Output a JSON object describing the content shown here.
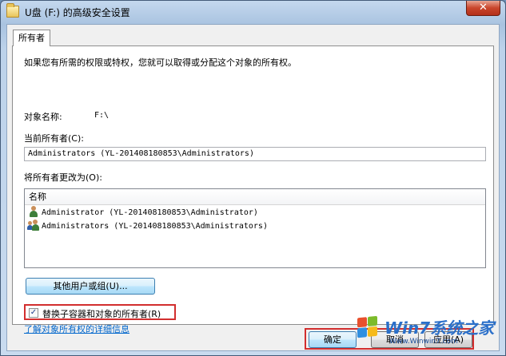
{
  "window": {
    "title": "U盘 (F:) 的高级安全设置",
    "close_glyph": "✕"
  },
  "tabs": [
    {
      "label": "所有者"
    }
  ],
  "panel": {
    "intro": "如果您有所需的权限或特权，您就可以取得或分配这个对象的所有权。",
    "object_name_label": "对象名称:",
    "object_name_value": "F:\\",
    "current_owner_label": "当前所有者(C):",
    "current_owner_value": "Administrators (YL-201408180853\\Administrators)",
    "change_owner_label": "将所有者更改为(O):",
    "list": {
      "header": "名称",
      "items": [
        {
          "icon": "user-icon",
          "text": "Administrator (YL-201408180853\\Administrator)"
        },
        {
          "icon": "group-icon",
          "text": "Administrators (YL-201408180853\\Administrators)"
        }
      ]
    },
    "other_users_button": "其他用户或组(U)...",
    "replace_checkbox": {
      "label": "替换子容器和对象的所有者(R)",
      "checked": true,
      "check_glyph": "✓"
    },
    "learn_more_link": "了解对象所有权的详细信息"
  },
  "buttons": {
    "ok": "确定",
    "cancel": "取消",
    "apply": "应用(A)"
  },
  "watermark": {
    "text": "Win7系统之家",
    "url": "Www.Winwin7.com"
  }
}
